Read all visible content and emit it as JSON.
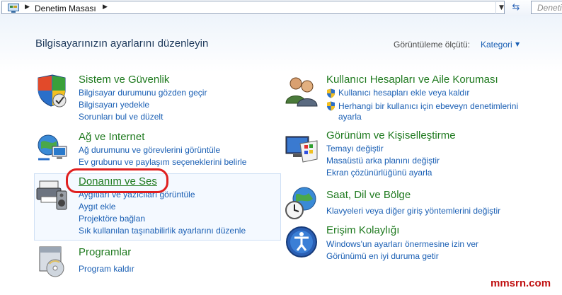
{
  "address_bar": {
    "breadcrumb": [
      "Denetim Masası"
    ],
    "search_placeholder": "Denetim Masası'nda Ara"
  },
  "header": {
    "title": "Bilgisayarınızın ayarlarını düzenleyin",
    "view_label": "Görüntüleme ölçütü:",
    "view_value": "Kategori"
  },
  "categories": [
    {
      "title": "Sistem ve Güvenlik",
      "icon": "shield-checkmark-icon",
      "links": [
        "Bilgisayar durumunu gözden geçir",
        "Bilgisayarı yedekle",
        "Sorunları bul ve düzelt"
      ]
    },
    {
      "title": "Ağ ve Internet",
      "icon": "network-globe-icon",
      "links": [
        "Ağ durumunu ve görevlerini görüntüle",
        "Ev grubunu ve paylaşım seçeneklerini belirle"
      ]
    },
    {
      "title": "Donanım ve Ses",
      "icon": "printer-speaker-icon",
      "links": [
        "Aygıtları ve yazıcıları görüntüle",
        "Aygıt ekle",
        "Projektöre bağlan",
        "Sık kullanılan taşınabilirlik ayarlarını düzenle"
      ]
    },
    {
      "title": "Programlar",
      "icon": "programs-disc-icon",
      "links": [
        "Program kaldır"
      ]
    },
    {
      "title": "Kullanıcı Hesapları ve Aile Koruması",
      "icon": "users-icon",
      "links": [
        "Kullanıcı hesapları ekle veya kaldır",
        "Herhangi bir kullanıcı için ebeveyn denetimlerini",
        "ayarla"
      ]
    },
    {
      "title": "Görünüm ve Kişiselleştirme",
      "icon": "monitor-palette-icon",
      "links": [
        "Temayı değiştir",
        "Masaüstü arka planını değiştir",
        "Ekran çözünürlüğünü ayarla"
      ]
    },
    {
      "title": "Saat, Dil ve Bölge",
      "icon": "clock-globe-icon",
      "links": [
        "Klavyeleri veya diğer giriş yöntemlerini değiştir"
      ]
    },
    {
      "title": "Erişim Kolaylığı",
      "icon": "accessibility-icon",
      "links": [
        "Windows'un ayarları önermesine izin ver",
        "Görünümü en iyi duruma getir"
      ]
    }
  ],
  "watermark": "mmsrn.com",
  "colors": {
    "category_title": "#1f7a1f",
    "link": "#1a5fb4",
    "highlight_ring": "#e01f1f"
  }
}
